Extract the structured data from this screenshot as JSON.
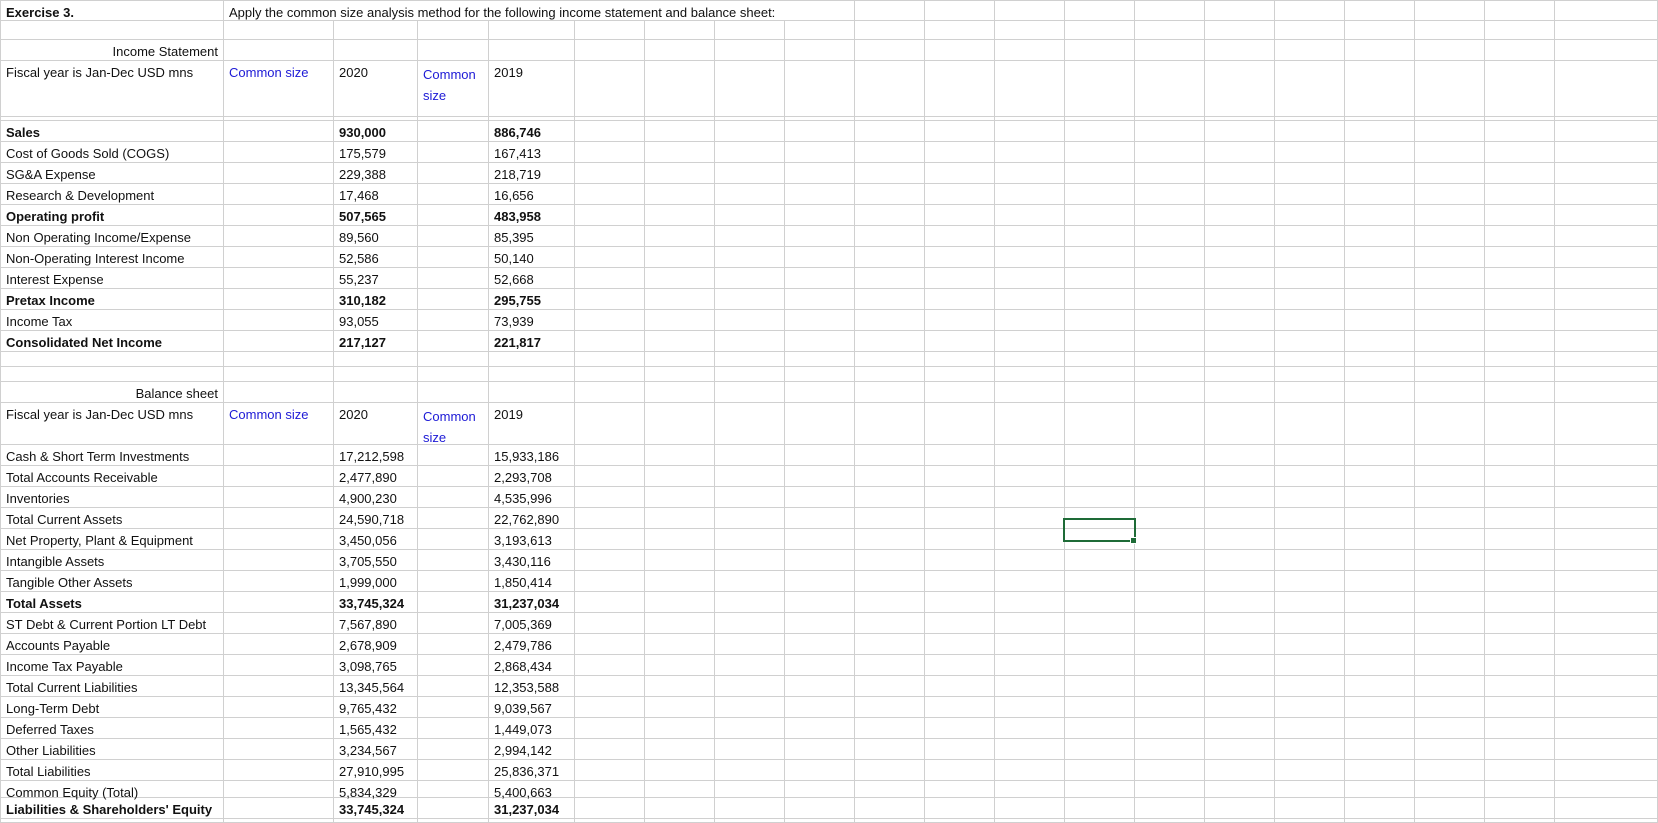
{
  "exercise": {
    "label": "Exercise 3.",
    "instruction": "Apply the common size analysis method for the following income statement and balance sheet:"
  },
  "income_statement": {
    "title": "Income Statement",
    "fiscal_label": "Fiscal year is Jan-Dec USD mns",
    "common_size_label": "Common size",
    "year_2020": "2020",
    "common_size_label_2": "Common size",
    "year_2019": "2019",
    "rows": [
      {
        "label": "Sales",
        "v2020": "930,000",
        "v2019": "886,746",
        "bold": true
      },
      {
        "label": "Cost of Goods Sold (COGS)",
        "v2020": "175,579",
        "v2019": "167,413",
        "bold": false
      },
      {
        "label": "SG&A Expense",
        "v2020": "229,388",
        "v2019": "218,719",
        "bold": false
      },
      {
        "label": "Research & Development",
        "v2020": "17,468",
        "v2019": "16,656",
        "bold": false
      },
      {
        "label": "Operating profit",
        "v2020": "507,565",
        "v2019": "483,958",
        "bold": true
      },
      {
        "label": "Non Operating Income/Expense",
        "v2020": "89,560",
        "v2019": "85,395",
        "bold": false
      },
      {
        "label": "Non-Operating Interest Income",
        "v2020": "52,586",
        "v2019": "50,140",
        "bold": false
      },
      {
        "label": "Interest Expense",
        "v2020": "55,237",
        "v2019": "52,668",
        "bold": false
      },
      {
        "label": "Pretax Income",
        "v2020": "310,182",
        "v2019": "295,755",
        "bold": true
      },
      {
        "label": "Income Tax",
        "v2020": "93,055",
        "v2019": "73,939",
        "bold": false
      },
      {
        "label": "Consolidated Net Income",
        "v2020": "217,127",
        "v2019": "221,817",
        "bold": true
      }
    ]
  },
  "balance_sheet": {
    "title": "Balance sheet",
    "fiscal_label": "Fiscal year is Jan-Dec USD mns",
    "common_size_label": "Common size",
    "year_2020": "2020",
    "common_size_label_2": "Common size",
    "year_2019": "2019",
    "rows": [
      {
        "label": "Cash & Short Term Investments",
        "v2020": "17,212,598",
        "v2019": "15,933,186",
        "bold": false
      },
      {
        "label": "Total Accounts Receivable",
        "v2020": "2,477,890",
        "v2019": "2,293,708",
        "bold": false
      },
      {
        "label": "Inventories",
        "v2020": "4,900,230",
        "v2019": "4,535,996",
        "bold": false
      },
      {
        "label": "Total Current Assets",
        "v2020": "24,590,718",
        "v2019": "22,762,890",
        "bold": false
      },
      {
        "label": "Net Property, Plant & Equipment",
        "v2020": "3,450,056",
        "v2019": "3,193,613",
        "bold": false
      },
      {
        "label": "Intangible Assets",
        "v2020": "3,705,550",
        "v2019": "3,430,116",
        "bold": false
      },
      {
        "label": "Tangible Other Assets",
        "v2020": "1,999,000",
        "v2019": "1,850,414",
        "bold": false
      },
      {
        "label": "Total Assets",
        "v2020": "33,745,324",
        "v2019": "31,237,034",
        "bold": true
      },
      {
        "label": "ST Debt & Current Portion LT Debt",
        "v2020": "7,567,890",
        "v2019": "7,005,369",
        "bold": false
      },
      {
        "label": "Accounts Payable",
        "v2020": "2,678,909",
        "v2019": "2,479,786",
        "bold": false
      },
      {
        "label": "Income Tax Payable",
        "v2020": "3,098,765",
        "v2019": "2,868,434",
        "bold": false
      },
      {
        "label": "Total Current Liabilities",
        "v2020": "13,345,564",
        "v2019": "12,353,588",
        "bold": false
      },
      {
        "label": "Long-Term Debt",
        "v2020": "9,765,432",
        "v2019": "9,039,567",
        "bold": false
      },
      {
        "label": "Deferred Taxes",
        "v2020": "1,565,432",
        "v2019": "1,449,073",
        "bold": false
      },
      {
        "label": "Other Liabilities",
        "v2020": "3,234,567",
        "v2019": "2,994,142",
        "bold": false
      },
      {
        "label": "Total Liabilities",
        "v2020": "27,910,995",
        "v2019": "25,836,371",
        "bold": false
      },
      {
        "label": "Common Equity (Total)",
        "v2020": "5,834,329",
        "v2019": "5,400,663",
        "bold": false
      },
      {
        "label": "Liabilities & Shareholders' Equity",
        "v2020": "33,745,324",
        "v2019": "31,237,034",
        "bold": true
      }
    ]
  },
  "colors": {
    "header_link_blue": "#1d1ad6",
    "selection_green": "#1e6b37",
    "gridline": "#d0d0d0"
  }
}
